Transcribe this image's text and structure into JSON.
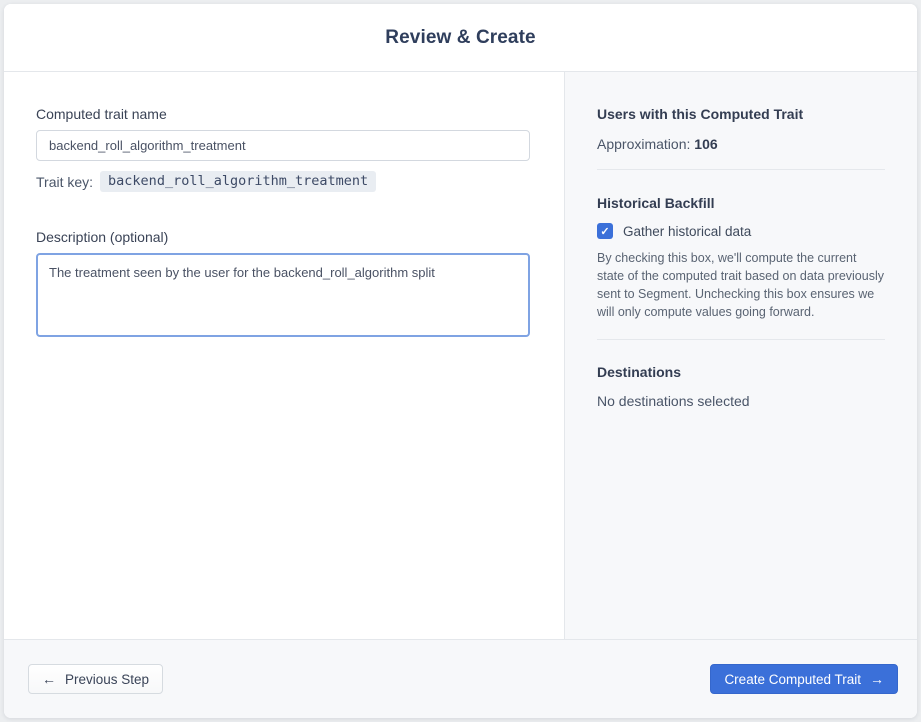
{
  "header": {
    "title": "Review & Create"
  },
  "form": {
    "name_label": "Computed trait name",
    "name_value": "backend_roll_algorithm_treatment",
    "trait_key_label": "Trait key:",
    "trait_key_value": "backend_roll_algorithm_treatment",
    "description_label": "Description (optional)",
    "description_value": "The treatment seen by the user for the backend_roll_algorithm split"
  },
  "summary": {
    "users_heading": "Users with this Computed Trait",
    "approximation_label": "Approximation:",
    "approximation_value": "106",
    "backfill_heading": "Historical Backfill",
    "backfill_checkbox_label": "Gather historical data",
    "backfill_checkbox_checked": true,
    "backfill_description": "By checking this box, we'll compute the current state of the computed trait based on data previously sent to Segment. Unchecking this box ensures we will only compute values going forward.",
    "destinations_heading": "Destinations",
    "destinations_value": "No destinations selected"
  },
  "footer": {
    "previous_label": "Previous Step",
    "create_label": "Create Computed Trait"
  },
  "icons": {
    "back_arrow": "←",
    "forward_arrow": "→",
    "checkmark": "✓"
  },
  "colors": {
    "accent_blue": "#3B70D9",
    "heading_navy": "#2F3E5C",
    "panel_gray": "#F7F8FA"
  }
}
